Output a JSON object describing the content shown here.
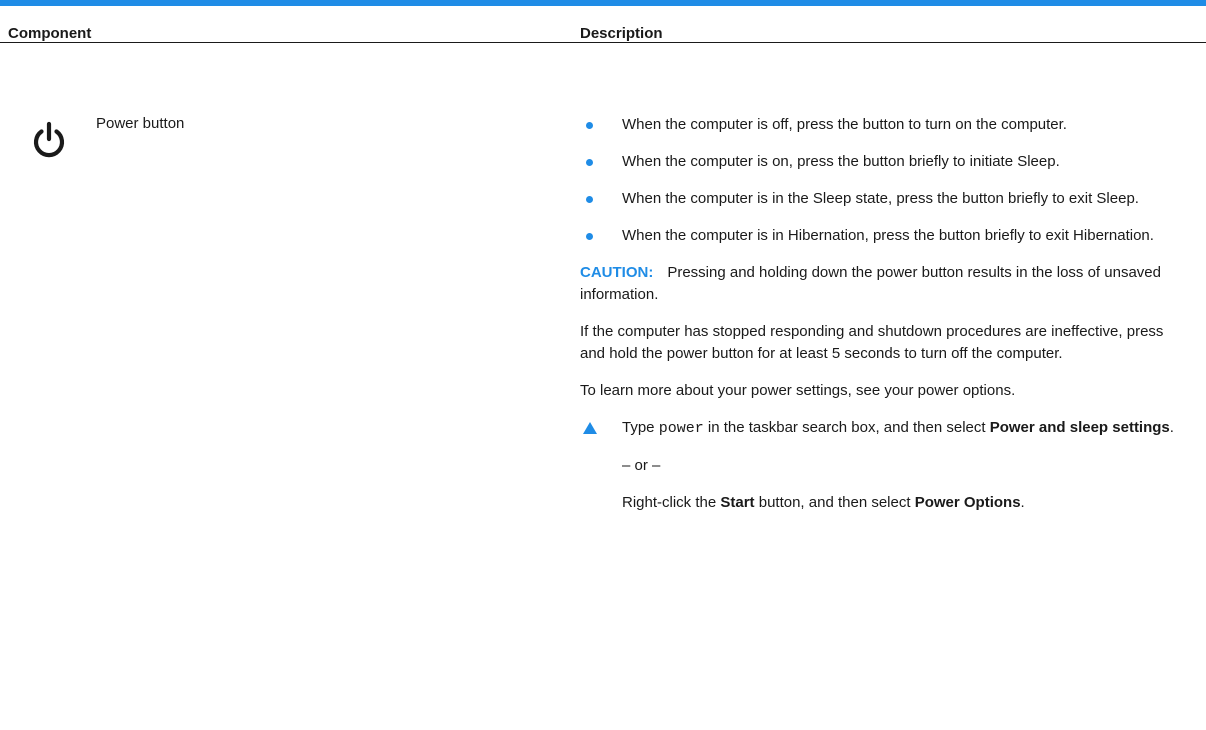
{
  "table": {
    "header": {
      "component": "Component",
      "description": "Description"
    },
    "row": {
      "icon": "power-icon",
      "component_name": "Power button",
      "bullets": [
        "When the computer is off, press the button to turn on the computer.",
        "When the computer is on, press the button briefly to initiate Sleep.",
        "When the computer is in the Sleep state, press the button briefly to exit Sleep.",
        "When the computer is in Hibernation, press the button briefly to exit Hibernation."
      ],
      "caution": {
        "label": "CAUTION:",
        "text": "Pressing and holding down the power button results in the loss of unsaved information."
      },
      "para_unresponsive": "If the computer has stopped responding and shutdown procedures are ineffective, press and hold the power button for at least 5 seconds to turn off the computer.",
      "para_learn": "To learn more about your power settings, see your power options.",
      "step": {
        "prefix": "Type ",
        "code": "power",
        "middle": " in the taskbar search box, and then select ",
        "bold": "Power and sleep settings",
        "suffix": "."
      },
      "or_text": "– or –",
      "alt": {
        "prefix": "Right-click the ",
        "bold1": "Start",
        "middle": " button, and then select ",
        "bold2": "Power Options",
        "suffix": "."
      }
    }
  },
  "colors": {
    "accent": "#1f8ce6",
    "text": "#1a1a1a"
  }
}
